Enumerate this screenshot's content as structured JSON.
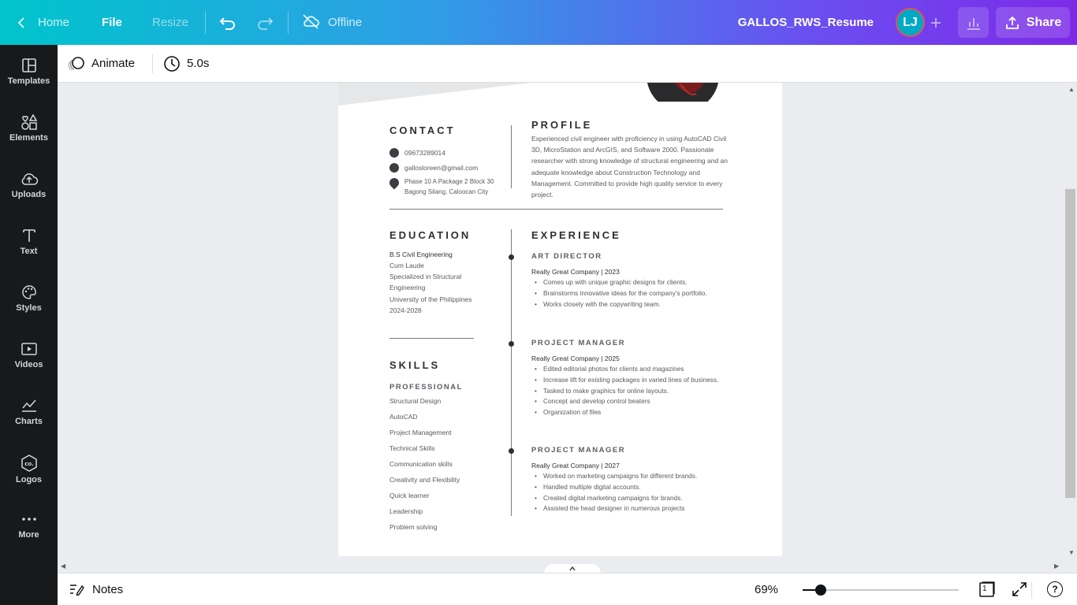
{
  "topbar": {
    "home_label": "Home",
    "file_label": "File",
    "resize_label": "Resize",
    "offline_label": "Offline",
    "doc_title": "GALLOS_RWS_Resume",
    "avatar_initials": "LJ",
    "share_label": "Share"
  },
  "sidebar": {
    "items": [
      {
        "label": "Templates",
        "icon": "templates-icon"
      },
      {
        "label": "Elements",
        "icon": "elements-icon"
      },
      {
        "label": "Uploads",
        "icon": "uploads-icon"
      },
      {
        "label": "Text",
        "icon": "text-icon"
      },
      {
        "label": "Styles",
        "icon": "styles-icon"
      },
      {
        "label": "Videos",
        "icon": "videos-icon"
      },
      {
        "label": "Charts",
        "icon": "charts-icon"
      },
      {
        "label": "Logos",
        "icon": "logos-icon"
      },
      {
        "label": "More",
        "icon": "more-icon"
      }
    ]
  },
  "subbar": {
    "animate_label": "Animate",
    "duration_label": "5.0s"
  },
  "resume": {
    "contact": {
      "heading": "CONTACT",
      "phone": "09673289014",
      "email": "gallosloreen@gmail.com",
      "address_line1": "Phase 10 A Package 2 Block 30",
      "address_line2": "Bagong Silang, Caloocan City"
    },
    "profile": {
      "heading": "PROFILE",
      "text": "Experienced civil engineer with proficiency in using AutoCAD Civil 3D, MicroStation and ArcGIS, and Software 2000. Passionate researcher with strong knowledge of structural engineering and an adequate knowledge about Construction Technology and Management. Committed to provide high quality service to every project."
    },
    "education": {
      "heading": "EDUCATION",
      "degree": "B.S Civil Engineering",
      "honor": "Cum Laude",
      "specialization": "Specialized in Structural Engineering",
      "school": "University of the Philippines",
      "years": "2024-2028"
    },
    "skills": {
      "heading": "SKILLS",
      "subheading": "PROFESSIONAL",
      "items": [
        "Structural Design",
        "AutoCAD",
        "Project Management",
        "Technical Skills",
        "Communication skills",
        "Creativity and Flexibility",
        "Quick learner",
        "Leadership",
        "Problem solving"
      ]
    },
    "experience": {
      "heading": "EXPERIENCE",
      "jobs": [
        {
          "title": "ART DIRECTOR",
          "company": "Really Great Company  | 2023",
          "bullets": [
            "Comes up with unique graphic designs for clients.",
            "Brainstorms innovative ideas for the company's portfolio.",
            "Works closely with the copywriting team."
          ]
        },
        {
          "title": "PROJECT MANAGER",
          "company": "Really Great Company  | 2025",
          "bullets": [
            "Edited editorial photos for clients and magazines",
            "Increase lift for existing packages in varied lines of business.",
            "Tasked to make graphics for online layouts.",
            "Concept and develop control beaters",
            "Organization of files"
          ]
        },
        {
          "title": "PROJECT MANAGER",
          "company": "Really Great Company  | 2027",
          "bullets": [
            "Worked on marketing campaigns for different brands.",
            "Handled multiple digital accounts.",
            "Created digital marketing campaigns for brands.",
            "Assisted the head designer in numerous projects"
          ]
        }
      ]
    }
  },
  "bottombar": {
    "notes_label": "Notes",
    "zoom_label": "69%",
    "zoom_level_percent": 69,
    "page_count": "1",
    "help_label": "?"
  },
  "colors": {
    "gradient_start": "#00c4cc",
    "gradient_end": "#7d2ae8",
    "sidebar_bg": "#18191b",
    "avatar_bg": "#00a9c4"
  }
}
